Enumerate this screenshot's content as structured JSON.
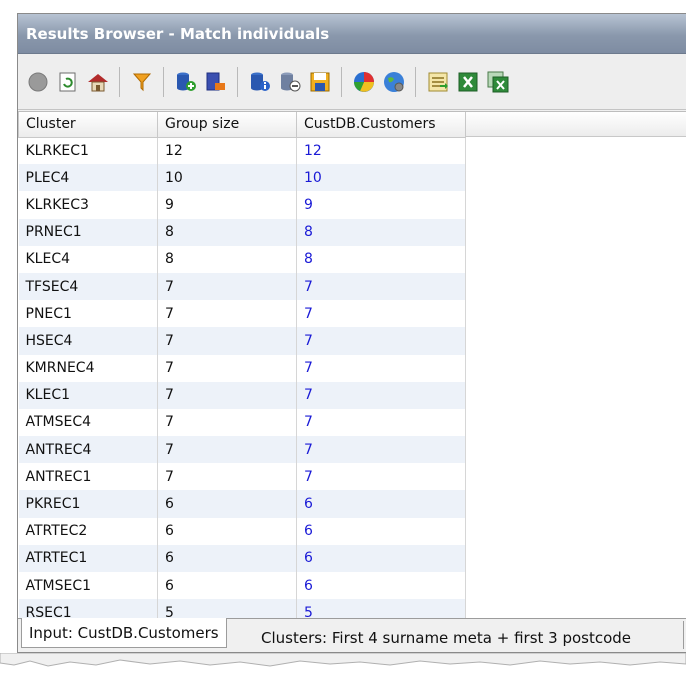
{
  "window": {
    "title": "Results Browser - Match individuals"
  },
  "toolbar": {
    "buttons": [
      {
        "icon": "stop-icon"
      },
      {
        "icon": "refresh-icon"
      },
      {
        "icon": "home-icon"
      },
      {
        "icon": "filter-icon"
      },
      {
        "icon": "database-add-icon"
      },
      {
        "icon": "database-export-icon"
      },
      {
        "icon": "database-info-icon"
      },
      {
        "icon": "database-link-icon"
      },
      {
        "icon": "save-icon"
      },
      {
        "icon": "pie-chart-icon"
      },
      {
        "icon": "globe-icon"
      },
      {
        "icon": "report-icon"
      },
      {
        "icon": "excel-icon"
      },
      {
        "icon": "excel-export-icon"
      }
    ]
  },
  "table": {
    "headers": [
      "Cluster",
      "Group size",
      "CustDB.Customers"
    ],
    "rows": [
      [
        "KLRKEC1",
        "12",
        "12"
      ],
      [
        "PLEC4",
        "10",
        "10"
      ],
      [
        "KLRKEC3",
        "9",
        "9"
      ],
      [
        "PRNEC1",
        "8",
        "8"
      ],
      [
        "KLEC4",
        "8",
        "8"
      ],
      [
        "TFSEC4",
        "7",
        "7"
      ],
      [
        "PNEC1",
        "7",
        "7"
      ],
      [
        "HSEC4",
        "7",
        "7"
      ],
      [
        "KMRNEC4",
        "7",
        "7"
      ],
      [
        "KLEC1",
        "7",
        "7"
      ],
      [
        "ATMSEC4",
        "7",
        "7"
      ],
      [
        "ANTREC4",
        "7",
        "7"
      ],
      [
        "ANTREC1",
        "7",
        "7"
      ],
      [
        "PKREC1",
        "6",
        "6"
      ],
      [
        "ATRTEC2",
        "6",
        "6"
      ],
      [
        "ATRTEC1",
        "6",
        "6"
      ],
      [
        "ATMSEC1",
        "6",
        "6"
      ],
      [
        "RSEC1",
        "5",
        "5"
      ]
    ]
  },
  "tabs": [
    {
      "label": "Input: CustDB.Customers"
    },
    {
      "label": "Clusters: First 4 surname meta + first 3 postcode"
    }
  ],
  "colors": {
    "title_bar": "#8a98ac",
    "link_value": "#1a1ad6",
    "alt_row": "#edf2f9"
  }
}
